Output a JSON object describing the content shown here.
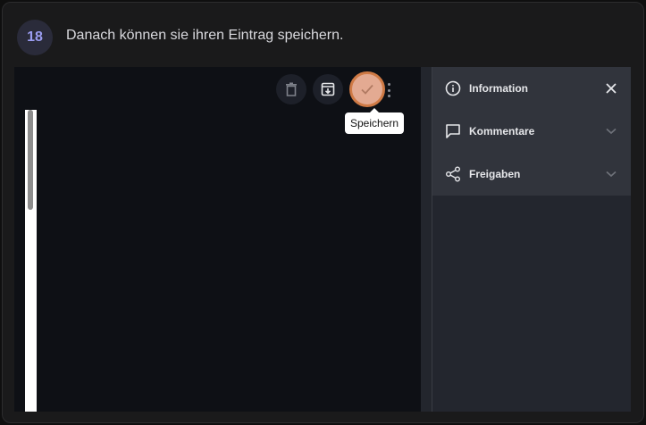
{
  "step": {
    "number": "18",
    "instruction": "Danach können sie ihren Eintrag speichern."
  },
  "toolbar": {
    "delete_icon": "trash-icon",
    "archive_icon": "archive-download-icon",
    "save_icon": "check-icon",
    "more_icon": "more-vertical-icon",
    "tooltip": "Speichern"
  },
  "panel": {
    "items": [
      {
        "label": "Information",
        "icon": "info-icon",
        "action": "close-icon"
      },
      {
        "label": "Kommentare",
        "icon": "comment-icon",
        "action": "chevron-down-icon"
      },
      {
        "label": "Freigaben",
        "icon": "share-icon",
        "action": "chevron-down-icon"
      }
    ]
  },
  "colors": {
    "accent_badge": "#9a9cf0",
    "save_highlight": "#cf7a45",
    "save_fill": "#e3aa92"
  }
}
